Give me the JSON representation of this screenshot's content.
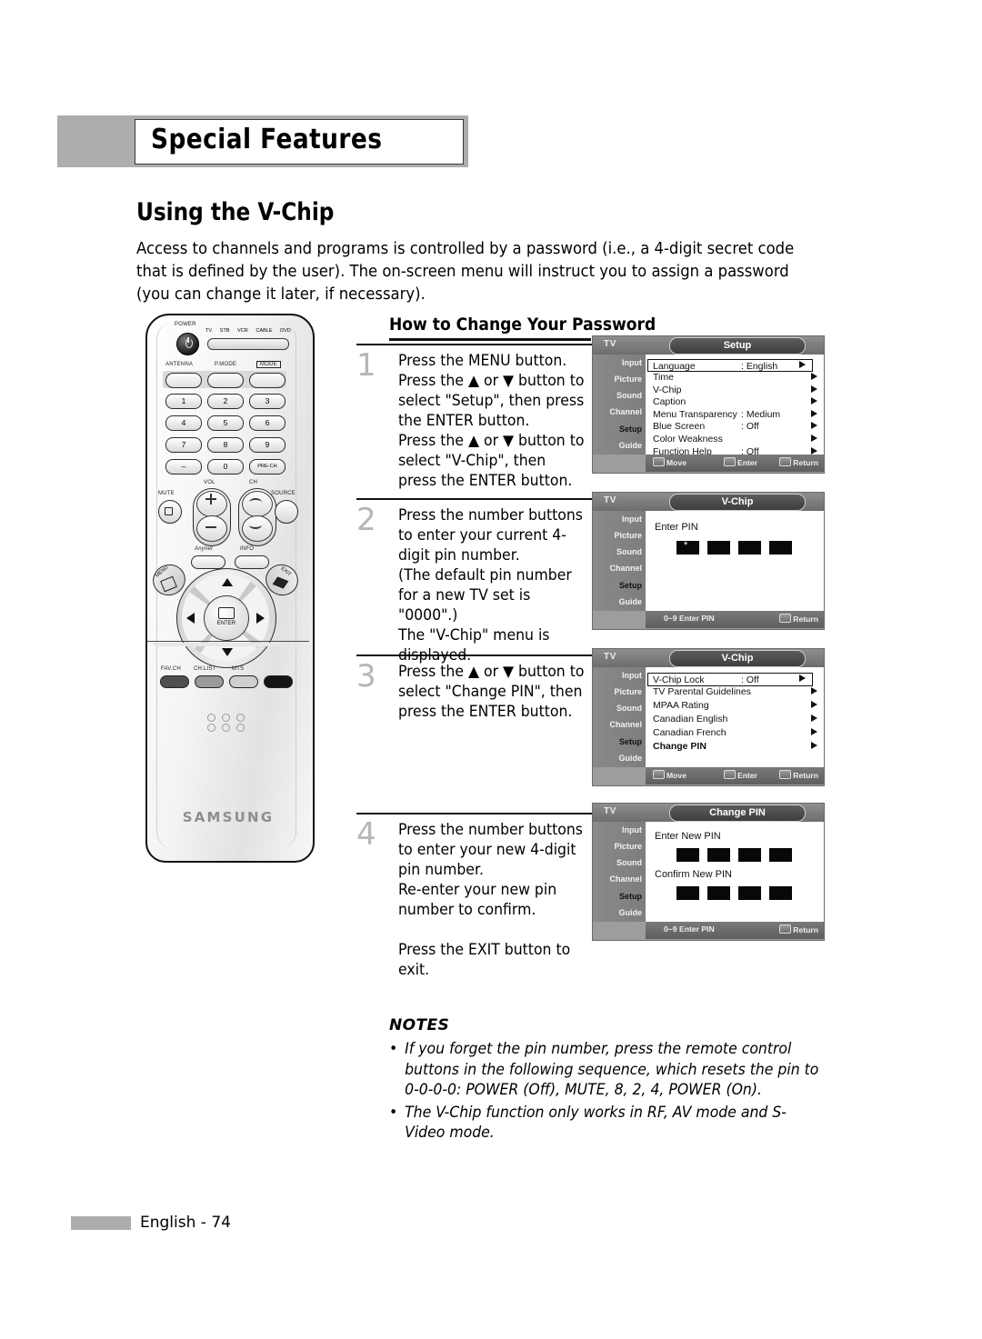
{
  "chapter": {
    "title": "Special Features"
  },
  "section": {
    "title": "Using the V-Chip"
  },
  "intro": "Access to channels and programs is controlled by a password (i.e., a 4-digit secret code that is defined by the user). The on-screen menu will instruct you to assign a password (you can change it later, if necessary).",
  "howto": {
    "heading": "How to Change Your Password"
  },
  "steps": [
    {
      "num": "1",
      "text": "Press the MENU button.\nPress the ▲ or ▼ button to select \"Setup\", then press the ENTER button.\nPress the ▲ or ▼ button to select \"V-Chip\", then press the ENTER button."
    },
    {
      "num": "2",
      "text": "Press the number buttons to enter your current 4-digit pin number.\n(The default pin number for a new TV set is \"0000\".)\nThe \"V-Chip\" menu is displayed."
    },
    {
      "num": "3",
      "text": "Press the ▲ or ▼ button to select \"Change PIN\", then press the ENTER button."
    },
    {
      "num": "4",
      "text": "Press the number buttons to enter your new 4-digit pin number.\nRe-enter your new pin number to confirm.\n\nPress the EXIT button to exit."
    }
  ],
  "osd_sidebar": [
    {
      "label": "Input",
      "icon": "input-icon",
      "active": false
    },
    {
      "label": "Picture",
      "icon": "picture-icon",
      "active": false
    },
    {
      "label": "Sound",
      "icon": "sound-icon",
      "active": false
    },
    {
      "label": "Channel",
      "icon": "channel-icon",
      "active": false
    },
    {
      "label": "Setup",
      "icon": "setup-icon",
      "active": true
    },
    {
      "label": "Guide",
      "icon": "guide-icon",
      "active": false
    }
  ],
  "osd": {
    "tv_label": "TV",
    "setup": {
      "title": "Setup",
      "rows": [
        {
          "label": "Language",
          "value": ": English",
          "selected": true
        },
        {
          "label": "Time",
          "value": "",
          "selected": false
        },
        {
          "label": "V-Chip",
          "value": "",
          "selected": false
        },
        {
          "label": "Caption",
          "value": "",
          "selected": false
        },
        {
          "label": "Menu Transparency",
          "value": ": Medium",
          "selected": false
        },
        {
          "label": "Blue Screen",
          "value": ": Off",
          "selected": false
        },
        {
          "label": "Color Weakness",
          "value": "",
          "selected": false
        },
        {
          "label": "Function Help",
          "value": ": Off",
          "selected": false
        }
      ],
      "footer": {
        "move": "Move",
        "enter": "Enter",
        "return": "Return"
      }
    },
    "vchip_pin": {
      "title": "V-Chip",
      "prompt": "Enter PIN",
      "footer": {
        "left": "0~9 Enter PIN",
        "return": "Return"
      }
    },
    "vchip_menu": {
      "title": "V-Chip",
      "rows": [
        {
          "label": "V-Chip Lock",
          "value": ": Off",
          "selected": true
        },
        {
          "label": "TV Parental Guidelines",
          "value": "",
          "selected": false
        },
        {
          "label": "MPAA Rating",
          "value": "",
          "selected": false
        },
        {
          "label": "Canadian English",
          "value": "",
          "selected": false
        },
        {
          "label": "Canadian French",
          "value": "",
          "selected": false
        },
        {
          "label": "Change PIN",
          "value": "",
          "selected": false,
          "bold": true
        }
      ],
      "footer": {
        "move": "Move",
        "enter": "Enter",
        "return": "Return"
      }
    },
    "change_pin": {
      "title": "Change PIN",
      "prompt1": "Enter New PIN",
      "prompt2": "Confirm New PIN",
      "footer": {
        "left": "0~9 Enter PIN",
        "return": "Return"
      }
    }
  },
  "remote": {
    "power_label": "POWER",
    "mode_tags": [
      "TV",
      "STB",
      "VCR",
      "CABLE",
      "DVD"
    ],
    "fn_labels": [
      "ANTENNA",
      "P.MODE",
      "MODE"
    ],
    "keys": [
      "1",
      "2",
      "3",
      "4",
      "5",
      "6",
      "7",
      "8",
      "9",
      "–",
      "0",
      "PRE-CH"
    ],
    "mute_label": "MUTE",
    "vol_label": "VOL",
    "ch_label": "CH",
    "source_label": "SOURCE",
    "anynet_label": "Anynet",
    "info_label": "INFO",
    "menu_label": "MENU",
    "exit_label": "EXIT",
    "enter_label": "ENTER",
    "bottom_buttons": [
      "FAV.CH",
      "CH.LIST",
      "MTS"
    ],
    "brand": "SAMSUNG"
  },
  "notes": {
    "heading": "NOTES",
    "items": [
      "If you forget the pin number, press the remote control buttons in the following sequence, which resets the pin to 0-0-0-0: POWER (Off), MUTE, 8, 2, 4, POWER (On).",
      "The V-Chip function only works in RF, AV mode and S-Video mode."
    ]
  },
  "footer": {
    "page": "English - 74"
  },
  "colors": {
    "band": "#adadad",
    "step_number": "#b6b6b6",
    "osd_bg": "#9d9d9d"
  }
}
